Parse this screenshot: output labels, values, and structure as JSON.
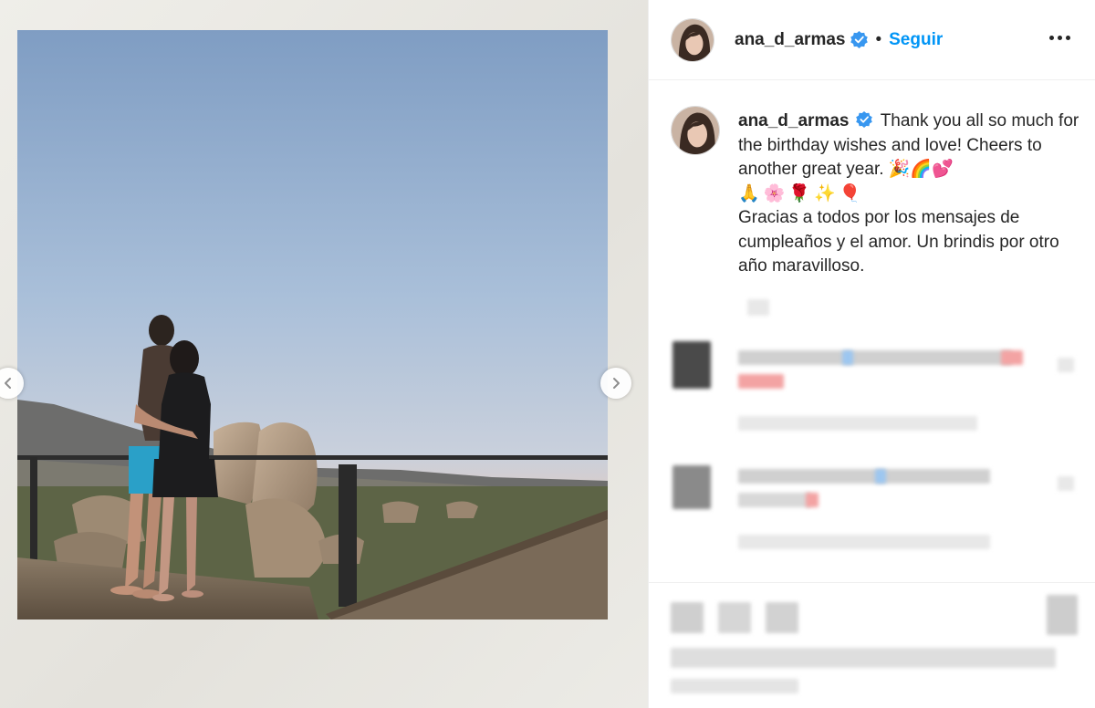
{
  "post": {
    "author": {
      "username": "ana_d_armas",
      "verified": true,
      "follow_label": "Seguir",
      "separator": "•"
    },
    "caption": {
      "username": "ana_d_armas",
      "line1": "Thank you all so much for the birthday wishes and love! Cheers to another great year. 🎉🌈💕",
      "line2": "🙏🌸🌹✨🎈",
      "line3": "Gracias a todos por los mensajes de cumpleaños y el amor. Un brindis por otro año maravilloso."
    },
    "comments_pixelated": true,
    "actions_pixelated": true
  },
  "icons": {
    "prev": "chevron-left-icon",
    "next": "chevron-right-icon",
    "verified": "verified-badge-icon",
    "more": "more-options-icon"
  },
  "colors": {
    "accent": "#0095f6",
    "verified": "#3897f0",
    "text": "#262626",
    "border": "#efefef"
  }
}
